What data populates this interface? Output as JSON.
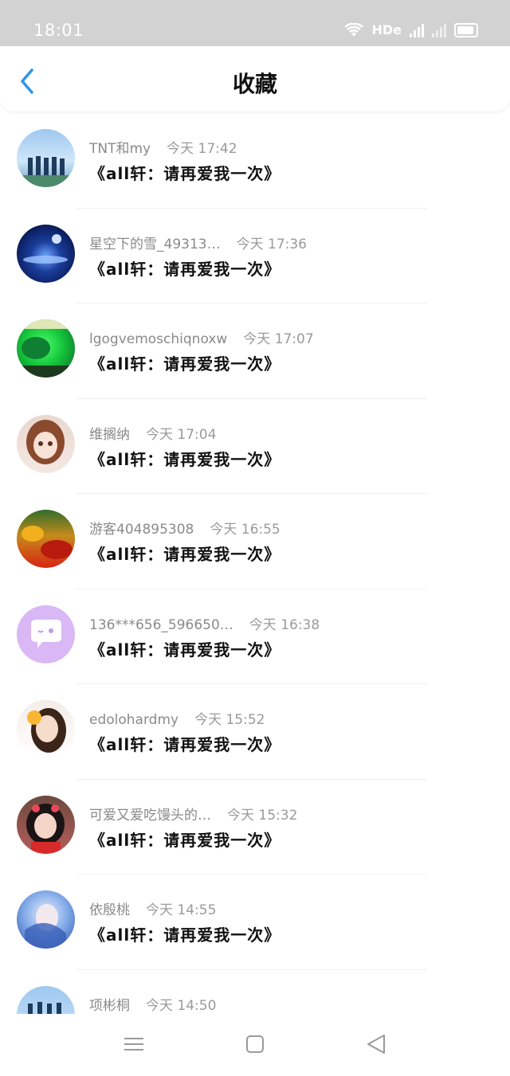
{
  "status_bar": {
    "time": "18:01",
    "network": "HDe",
    "signal_label": "4G"
  },
  "header": {
    "title": "收藏",
    "back_icon": "chevron-left-icon"
  },
  "colors": {
    "accent": "#2f95e8",
    "status_bar_bg": "#d2d2d2"
  },
  "items": [
    {
      "user": "TNT和my",
      "time": "今天 17:42",
      "message": "《all轩：请再爱我一次》"
    },
    {
      "user": "星空下的雪_49313…",
      "time": "今天 17:36",
      "message": "《all轩：请再爱我一次》"
    },
    {
      "user": "lgogvemoschiqnoxw",
      "time": "今天 17:07",
      "message": "《all轩：请再爱我一次》"
    },
    {
      "user": "维搁纳",
      "time": "今天 17:04",
      "message": "《all轩：请再爱我一次》"
    },
    {
      "user": "游客404895308",
      "time": "今天 16:55",
      "message": "《all轩：请再爱我一次》"
    },
    {
      "user": "136***656_596650…",
      "time": "今天 16:38",
      "message": "《all轩：请再爱我一次》"
    },
    {
      "user": "edolohardmy",
      "time": "今天 15:52",
      "message": "《all轩：请再爱我一次》"
    },
    {
      "user": "可爱又爱吃馒头的…",
      "time": "今天 15:32",
      "message": "《all轩：请再爱我一次》"
    },
    {
      "user": "依殷桃",
      "time": "今天 14:55",
      "message": "《all轩：请再爱我一次》"
    },
    {
      "user": "项彬桐",
      "time": "今天 14:50",
      "message": ""
    }
  ],
  "nav": {
    "menu_icon": "menu-icon",
    "home_icon": "home-square-icon",
    "back_icon": "back-triangle-icon"
  }
}
